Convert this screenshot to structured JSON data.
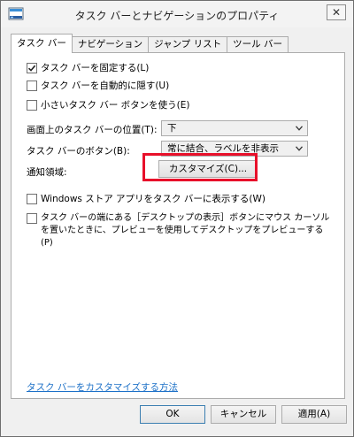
{
  "window": {
    "title": "タスク バーとナビゲーションのプロパティ",
    "close_glyph": "✕"
  },
  "tabs": [
    {
      "label": "タスク バー",
      "active": true
    },
    {
      "label": "ナビゲーション",
      "active": false
    },
    {
      "label": "ジャンプ リスト",
      "active": false
    },
    {
      "label": "ツール バー",
      "active": false
    }
  ],
  "taskbar_tab": {
    "lock_taskbar": {
      "label": "タスク バーを固定する(L)",
      "checked": true
    },
    "auto_hide": {
      "label": "タスク バーを自動的に隠す(U)",
      "checked": false
    },
    "small_buttons": {
      "label": "小さいタスク バー ボタンを使う(E)",
      "checked": false
    },
    "position": {
      "label": "画面上のタスク バーの位置(T):",
      "value": "下"
    },
    "buttons": {
      "label": "タスク バーのボタン(B):",
      "value": "常に結合、ラベルを非表示"
    },
    "notification": {
      "label": "通知領域:",
      "customize_label": "カスタマイズ(C)..."
    },
    "store_apps": {
      "label": "Windows ストア アプリをタスク バーに表示する(W)",
      "checked": false
    },
    "peek": {
      "label": "タスク バーの端にある［デスクトップの表示］ボタンにマウス カーソルを置いたときに、プレビューを使用してデスクトップをプレビューする(P)",
      "checked": false
    },
    "help_link": "タスク バーをカスタマイズする方法"
  },
  "footer": {
    "ok": "OK",
    "cancel": "キャンセル",
    "apply": "適用(A)"
  },
  "colors": {
    "highlight": "#e8102a",
    "link": "#1a6fc7"
  },
  "icons": {
    "app": "taskbar-app-icon",
    "close": "close-icon",
    "check": "checkmark-icon",
    "dropdown": "chevron-down-icon"
  }
}
